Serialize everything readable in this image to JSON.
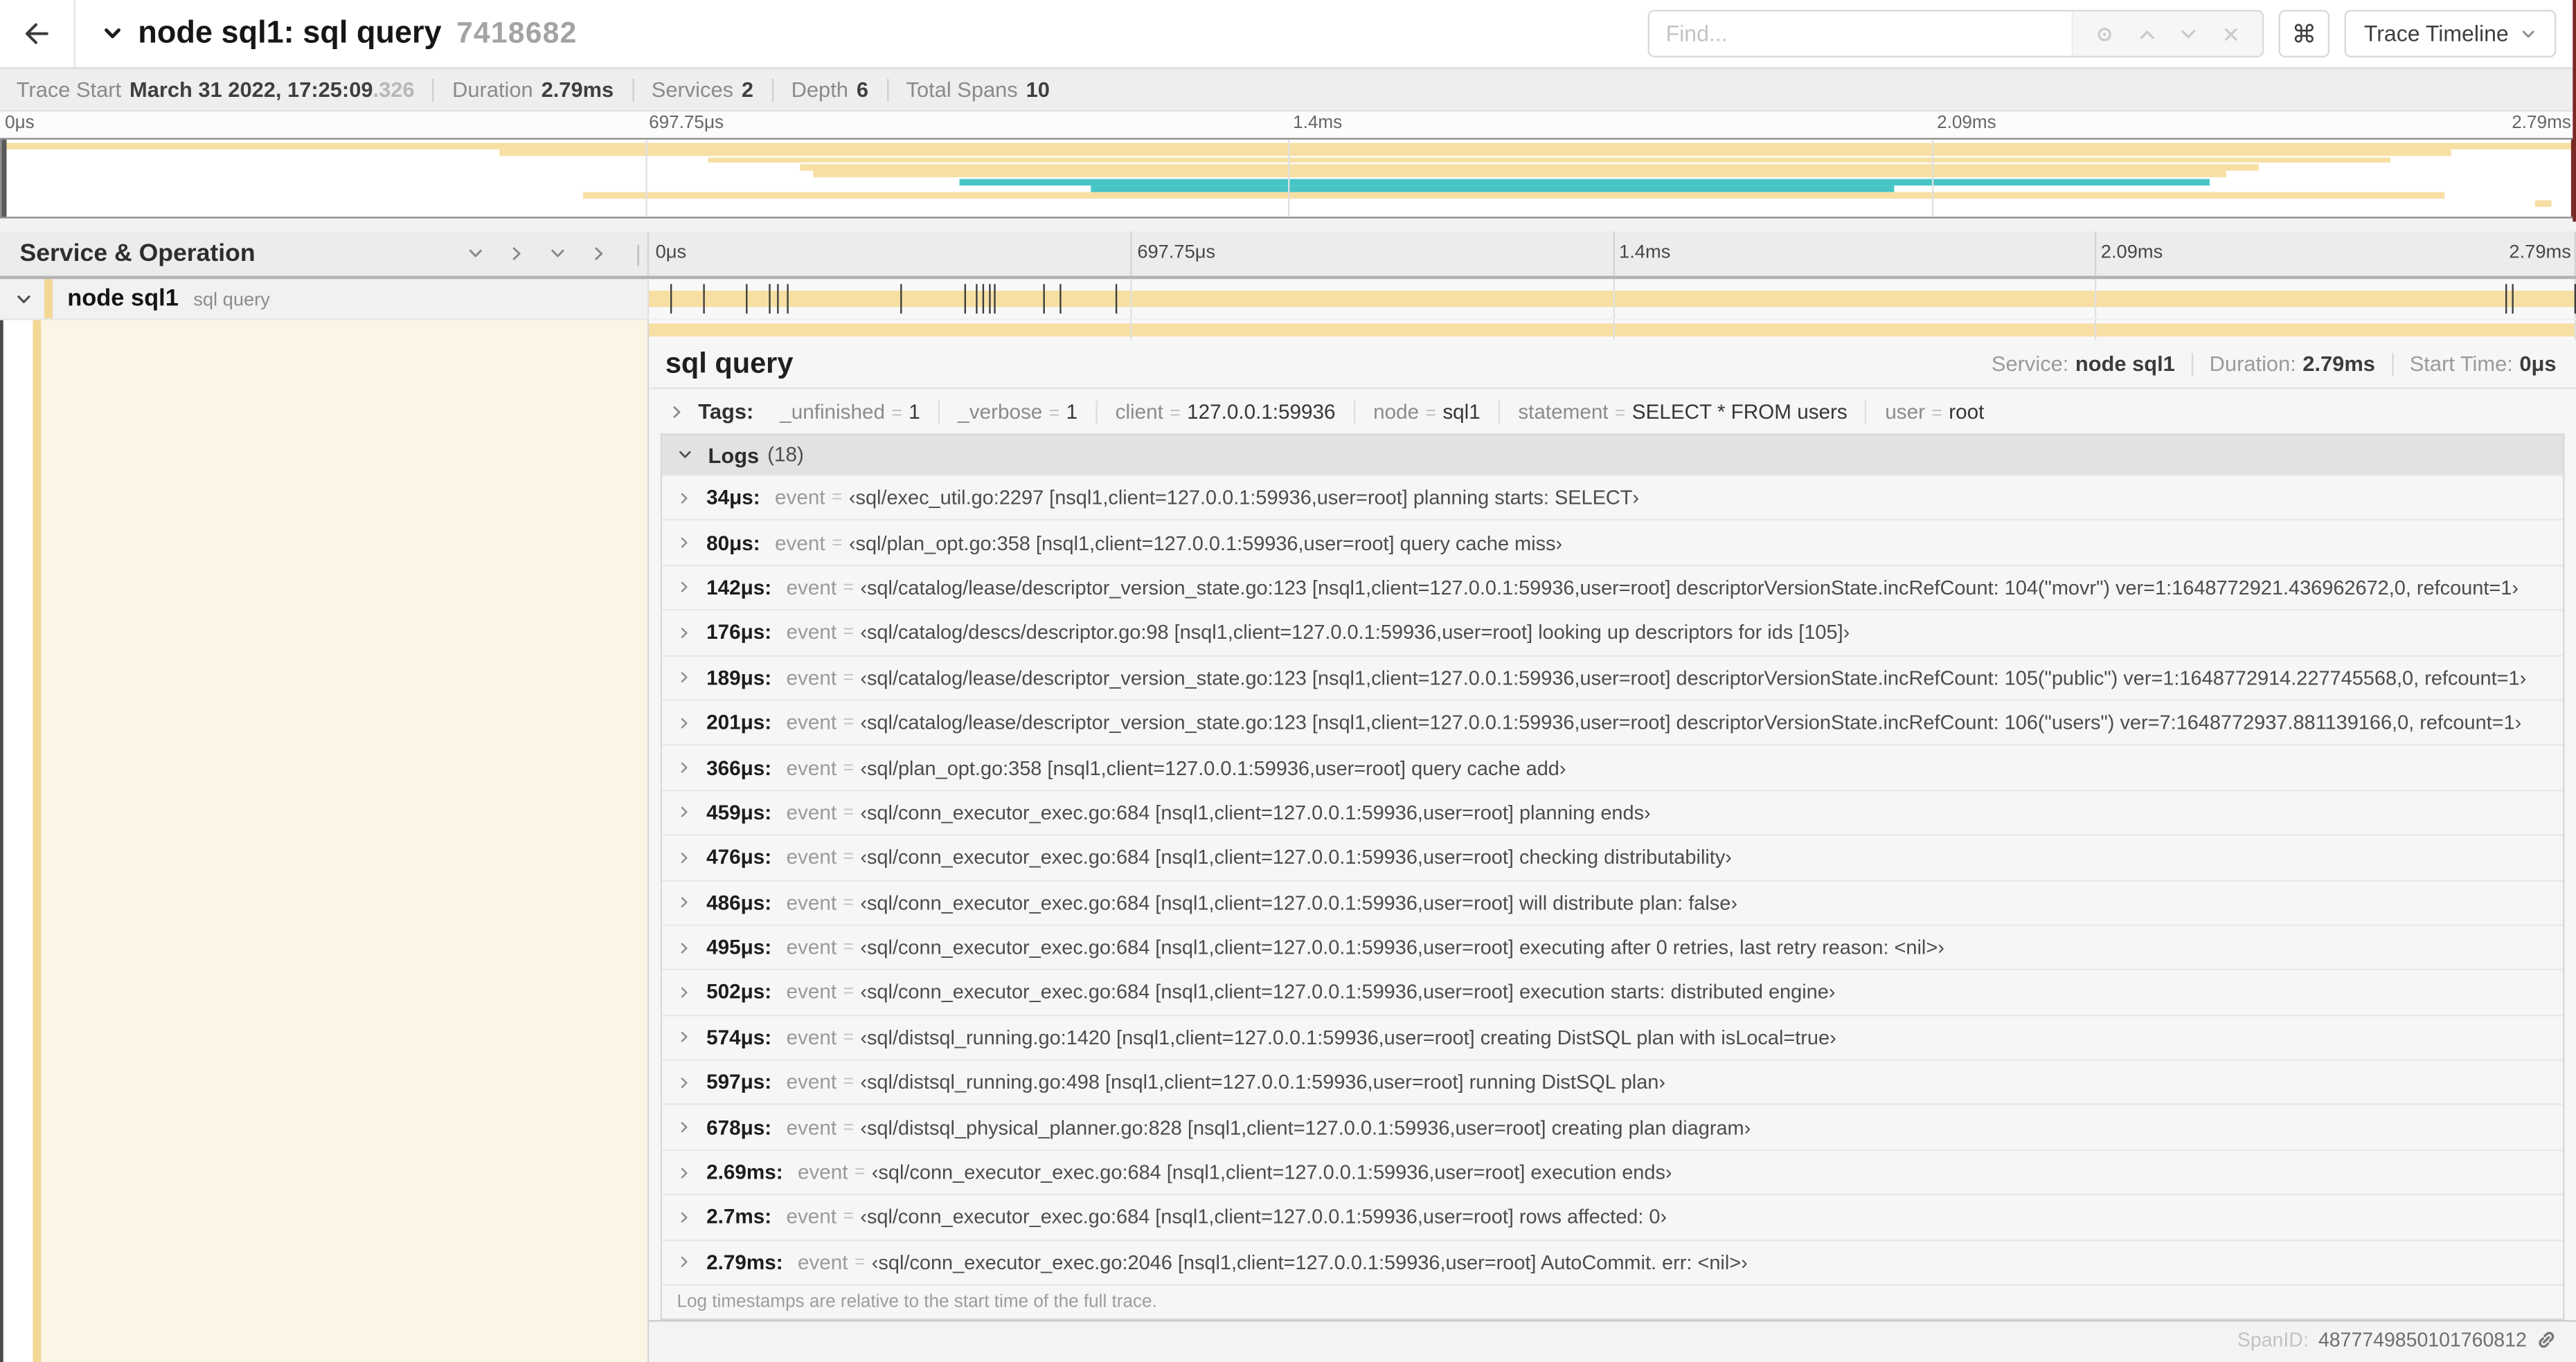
{
  "colors": {
    "span_bar_tan": "#F7DFA4",
    "span_bar_teal": "#47C5C5",
    "accent_stripe": "#F2D795",
    "selected_row_bg": "#FCF5E6",
    "minimap_right_scrubber": "#7A2A26"
  },
  "header": {
    "title": "node sql1: sql query",
    "trace_id": "7418682",
    "find_placeholder": "Find...",
    "shortcut_button": "⌘",
    "view_dropdown_label": "Trace Timeline"
  },
  "summary": {
    "items": [
      {
        "label": "Trace Start",
        "value": "March 31 2022, 17:25:09",
        "suffix": ".326"
      },
      {
        "label": "Duration",
        "value": "2.79ms"
      },
      {
        "label": "Services",
        "value": "2"
      },
      {
        "label": "Depth",
        "value": "6"
      },
      {
        "label": "Total Spans",
        "value": "10"
      }
    ]
  },
  "timeline": {
    "total_duration_us": 2790,
    "axis_ticks": [
      {
        "label": "0μs",
        "pct": 0
      },
      {
        "label": "697.75μs",
        "pct": 25
      },
      {
        "label": "1.4ms",
        "pct": 50
      },
      {
        "label": "2.09ms",
        "pct": 75
      },
      {
        "label": "2.79ms",
        "pct": 100
      }
    ]
  },
  "minimap": {
    "spans": [
      {
        "start_pct": 0,
        "end_pct": 100,
        "color": "tan"
      },
      {
        "start_pct": 19.3,
        "end_pct": 95.3,
        "color": "tan"
      },
      {
        "start_pct": 27.4,
        "end_pct": 92.9,
        "color": "tan"
      },
      {
        "start_pct": 31.0,
        "end_pct": 87.8,
        "color": "tan"
      },
      {
        "start_pct": 31.5,
        "end_pct": 86.5,
        "color": "tan"
      },
      {
        "start_pct": 37.2,
        "end_pct": 85.9,
        "color": "teal"
      },
      {
        "start_pct": 42.3,
        "end_pct": 73.6,
        "color": "teal"
      },
      {
        "start_pct": 22.6,
        "end_pct": 95.0,
        "color": "tan"
      },
      {
        "start_pct": 98.5,
        "end_pct": 99.2,
        "color": "tan"
      },
      {
        "start_pct": 0,
        "end_pct": 0,
        "color": "tan"
      }
    ]
  },
  "span_list": {
    "header_label": "Service & Operation",
    "row": {
      "service": "node sql1",
      "operation": "sql query"
    },
    "log_marker_times_us": [
      34,
      80,
      142,
      176,
      189,
      201,
      366,
      459,
      476,
      486,
      495,
      502,
      574,
      597,
      678,
      2690,
      2700,
      2790
    ]
  },
  "detail": {
    "title": "sql query",
    "meta": [
      {
        "label": "Service:",
        "value": "node sql1"
      },
      {
        "label": "Duration:",
        "value": "2.79ms"
      },
      {
        "label": "Start Time:",
        "value": "0μs"
      }
    ],
    "tags_label": "Tags:",
    "eq_sign": "=",
    "tags": [
      {
        "key": "_unfinished",
        "value": "1"
      },
      {
        "key": "_verbose",
        "value": "1"
      },
      {
        "key": "client",
        "value": "127.0.0.1:59936"
      },
      {
        "key": "node",
        "value": "sql1"
      },
      {
        "key": "statement",
        "value": "SELECT * FROM users"
      },
      {
        "key": "user",
        "value": "root"
      }
    ],
    "logs_label": "Logs",
    "logs_count": "(18)",
    "log_field_key": "event",
    "logs": [
      {
        "time": "34μs:",
        "value": "‹sql/exec_util.go:2297 [nsql1,client=127.0.0.1:59936,user=root] planning starts: SELECT›"
      },
      {
        "time": "80μs:",
        "value": "‹sql/plan_opt.go:358 [nsql1,client=127.0.0.1:59936,user=root] query cache miss›"
      },
      {
        "time": "142μs:",
        "value": "‹sql/catalog/lease/descriptor_version_state.go:123 [nsql1,client=127.0.0.1:59936,user=root] descriptorVersionState.incRefCount: 104(\"movr\") ver=1:1648772921.436962672,0, refcount=1›"
      },
      {
        "time": "176μs:",
        "value": "‹sql/catalog/descs/descriptor.go:98 [nsql1,client=127.0.0.1:59936,user=root] looking up descriptors for ids [105]›"
      },
      {
        "time": "189μs:",
        "value": "‹sql/catalog/lease/descriptor_version_state.go:123 [nsql1,client=127.0.0.1:59936,user=root] descriptorVersionState.incRefCount: 105(\"public\") ver=1:1648772914.227745568,0, refcount=1›"
      },
      {
        "time": "201μs:",
        "value": "‹sql/catalog/lease/descriptor_version_state.go:123 [nsql1,client=127.0.0.1:59936,user=root] descriptorVersionState.incRefCount: 106(\"users\") ver=7:1648772937.881139166,0, refcount=1›"
      },
      {
        "time": "366μs:",
        "value": "‹sql/plan_opt.go:358 [nsql1,client=127.0.0.1:59936,user=root] query cache add›"
      },
      {
        "time": "459μs:",
        "value": "‹sql/conn_executor_exec.go:684 [nsql1,client=127.0.0.1:59936,user=root] planning ends›"
      },
      {
        "time": "476μs:",
        "value": "‹sql/conn_executor_exec.go:684 [nsql1,client=127.0.0.1:59936,user=root] checking distributability›"
      },
      {
        "time": "486μs:",
        "value": "‹sql/conn_executor_exec.go:684 [nsql1,client=127.0.0.1:59936,user=root] will distribute plan: false›"
      },
      {
        "time": "495μs:",
        "value": "‹sql/conn_executor_exec.go:684 [nsql1,client=127.0.0.1:59936,user=root] executing after 0 retries, last retry reason: <nil>›"
      },
      {
        "time": "502μs:",
        "value": "‹sql/conn_executor_exec.go:684 [nsql1,client=127.0.0.1:59936,user=root] execution starts: distributed engine›"
      },
      {
        "time": "574μs:",
        "value": "‹sql/distsql_running.go:1420 [nsql1,client=127.0.0.1:59936,user=root] creating DistSQL plan with isLocal=true›"
      },
      {
        "time": "597μs:",
        "value": "‹sql/distsql_running.go:498 [nsql1,client=127.0.0.1:59936,user=root] running DistSQL plan›"
      },
      {
        "time": "678μs:",
        "value": "‹sql/distsql_physical_planner.go:828 [nsql1,client=127.0.0.1:59936,user=root] creating plan diagram›"
      },
      {
        "time": "2.69ms:",
        "value": "‹sql/conn_executor_exec.go:684 [nsql1,client=127.0.0.1:59936,user=root] execution ends›"
      },
      {
        "time": "2.7ms:",
        "value": "‹sql/conn_executor_exec.go:684 [nsql1,client=127.0.0.1:59936,user=root] rows affected: 0›"
      },
      {
        "time": "2.79ms:",
        "value": "‹sql/conn_executor_exec.go:2046 [nsql1,client=127.0.0.1:59936,user=root] AutoCommit. err: <nil>›"
      }
    ],
    "footer_note": "Log timestamps are relative to the start time of the full trace.",
    "span_id_label": "SpanID:",
    "span_id": "4877749850101760812"
  }
}
